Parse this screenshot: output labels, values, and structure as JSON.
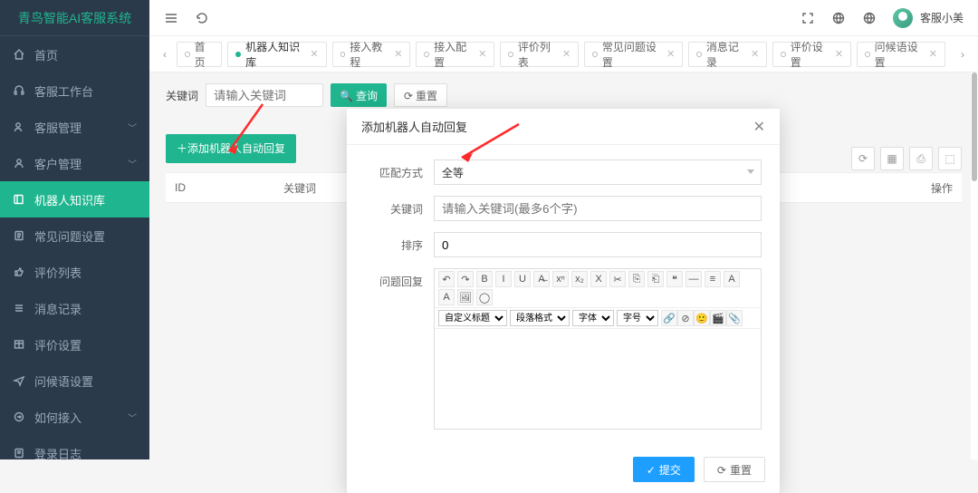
{
  "brand": "青鸟智能AI客服系统",
  "sidebar": {
    "items": [
      {
        "icon": "home-icon",
        "label": "首页"
      },
      {
        "icon": "headset-icon",
        "label": "客服工作台"
      },
      {
        "icon": "user-gear-icon",
        "label": "客服管理",
        "caret": true
      },
      {
        "icon": "user-icon",
        "label": "客户管理",
        "caret": true
      },
      {
        "icon": "book-icon",
        "label": "机器人知识库",
        "active": true
      },
      {
        "icon": "doc-icon",
        "label": "常见问题设置"
      },
      {
        "icon": "thumb-icon",
        "label": "评价列表"
      },
      {
        "icon": "list-icon",
        "label": "消息记录"
      },
      {
        "icon": "table-icon",
        "label": "评价设置"
      },
      {
        "icon": "send-icon",
        "label": "问候语设置"
      },
      {
        "icon": "arrow-icon",
        "label": "如何接入",
        "caret": true
      },
      {
        "icon": "log-icon",
        "label": "登录日志"
      }
    ]
  },
  "topbar": {
    "username": "客服小美"
  },
  "tabs": [
    {
      "label": "首页"
    },
    {
      "label": "机器人知识库",
      "current": true
    },
    {
      "label": "接入教程"
    },
    {
      "label": "接入配置"
    },
    {
      "label": "评价列表"
    },
    {
      "label": "常见问题设置"
    },
    {
      "label": "消息记录"
    },
    {
      "label": "评价设置"
    },
    {
      "label": "问候语设置"
    }
  ],
  "search": {
    "label": "关键词",
    "placeholder": "请输入关键词",
    "search_btn": "查询",
    "reset_btn": "重置"
  },
  "actions": {
    "add_btn": "＋添加机器人自动回复"
  },
  "table": {
    "columns": {
      "id": "ID",
      "keyword": "关键词",
      "op": "操作"
    }
  },
  "modal": {
    "title": "添加机器人自动回复",
    "match_label": "匹配方式",
    "match_value": "全等",
    "keyword_label": "关键词",
    "keyword_placeholder": "请输入关键词(最多6个字)",
    "sort_label": "排序",
    "sort_value": "0",
    "reply_label": "问题回复",
    "editor": {
      "row1": [
        "↶",
        "↷",
        "B",
        "I",
        "U",
        "A̶",
        "xⁿ",
        "x₂",
        "X",
        "✂",
        "⎘",
        "⎗",
        "❝",
        "—",
        "≡",
        "A",
        "A",
        "🖼",
        "◯"
      ],
      "selects": {
        "heading": "自定义标题",
        "paragraph": "段落格式",
        "font": "字体",
        "size": "字号"
      },
      "row2_icons": [
        "🔗",
        "⊘",
        "🙂",
        "🎬",
        "📎"
      ]
    },
    "submit_btn": "提交",
    "reset_btn": "重置"
  }
}
